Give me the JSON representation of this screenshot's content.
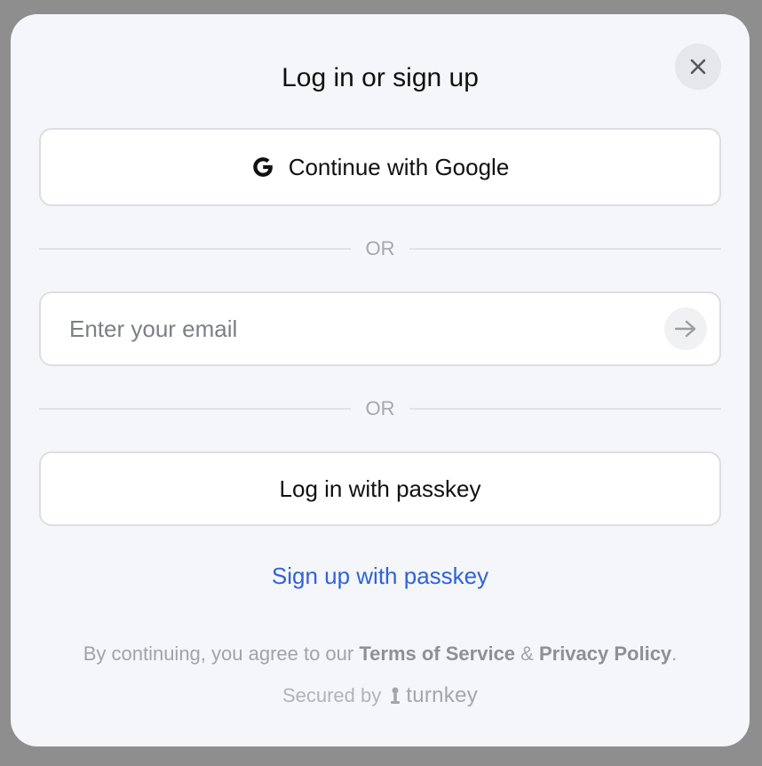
{
  "modal": {
    "title": "Log in or sign up",
    "close_icon": "close-icon"
  },
  "google": {
    "icon": "google-icon",
    "label": "Continue with Google"
  },
  "divider": {
    "label": "OR"
  },
  "email": {
    "value": "",
    "placeholder": "Enter your email",
    "submit_icon": "arrow-right-icon"
  },
  "passkey": {
    "login_label": "Log in with passkey",
    "signup_label": "Sign up with passkey"
  },
  "legal": {
    "prefix": "By continuing, you agree to our ",
    "terms": "Terms of Service",
    "and": " & ",
    "privacy": "Privacy Policy",
    "suffix": "."
  },
  "footer": {
    "secured_by": "Secured by",
    "brand_icon": "turnkey-logo-icon",
    "brand": "turnkey"
  },
  "colors": {
    "backdrop": "#8e8e8e",
    "modal_bg": "#f5f6fa",
    "link": "#2f63d9",
    "muted_text": "#a0a3a9"
  }
}
